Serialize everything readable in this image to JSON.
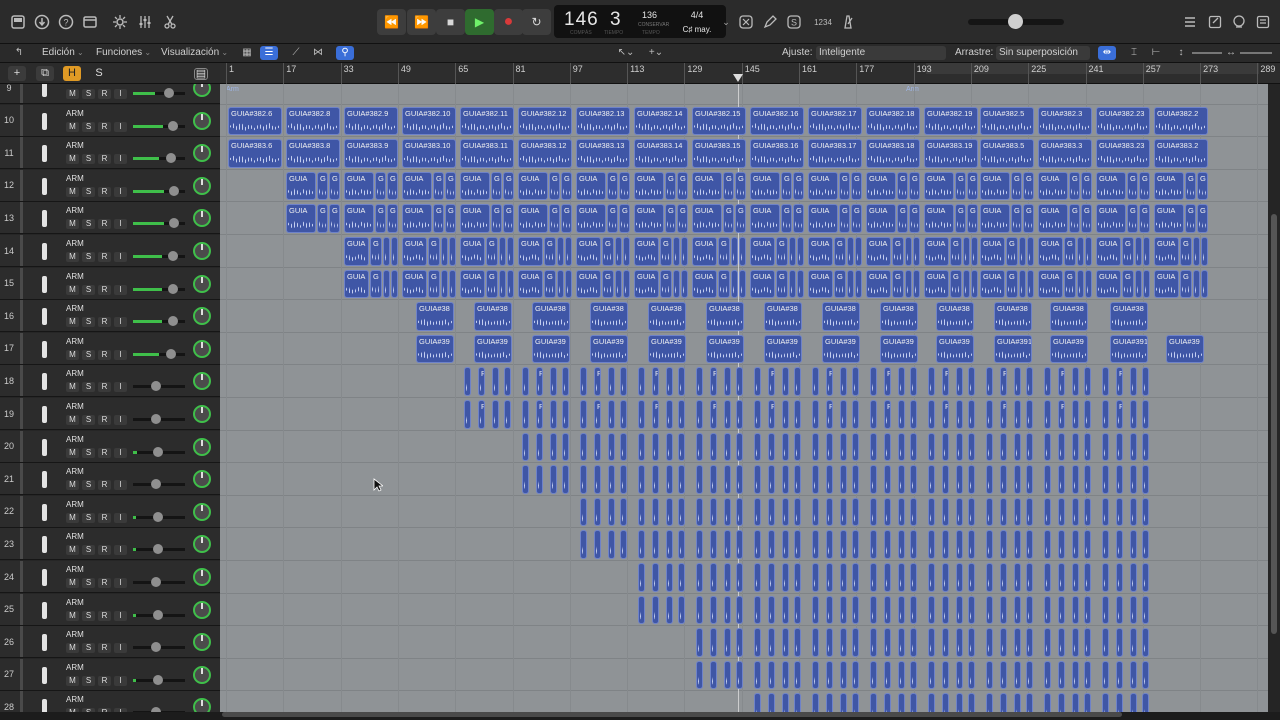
{
  "control_bar": {
    "left_icons": [
      "library-icon",
      "info-icon",
      "help-icon",
      "editors-icon",
      "settings-icon",
      "mixer-icon",
      "scissors-icon"
    ],
    "transport": {
      "rewind": "⏪",
      "forward": "⏩",
      "stop": "■",
      "play": "▶",
      "record": "●",
      "cycle": "↻"
    },
    "lcd": {
      "bars": "146",
      "beat": "3",
      "bars_label": "COMPÁS",
      "beat_label": "TIEMPO",
      "tempo": "136",
      "tempo_label": "CONSERVAR",
      "tempo_sublabel": "TEMPO",
      "signature": "4/4",
      "key": "C♯ may."
    },
    "right_icons": [
      "tuner-icon",
      "pencil-icon",
      "solo-icon",
      "count-in-icon",
      "metronome-icon"
    ],
    "count_in": "1234",
    "master_volume": 0.5,
    "far_right_icons": [
      "list-icon",
      "notepad-icon",
      "loops-icon",
      "browser-icon"
    ]
  },
  "toolbar": {
    "menus": [
      "Edición",
      "Funciones",
      "Visualización"
    ],
    "snap_label": "Ajuste:",
    "snap_value": "Inteligente",
    "drag_label": "Arrastre:",
    "drag_value": "Sin superposición"
  },
  "track_header": {
    "add": "+",
    "h": "H",
    "s": "S"
  },
  "tracks": [
    {
      "num": "9",
      "name": "",
      "vol": 0.42
    },
    {
      "num": "10",
      "name": "ARM",
      "vol": 0.58
    },
    {
      "num": "11",
      "name": "ARM",
      "vol": 0.5
    },
    {
      "num": "12",
      "name": "ARM",
      "vol": 0.6
    },
    {
      "num": "13",
      "name": "ARM",
      "vol": 0.6
    },
    {
      "num": "14",
      "name": "ARM",
      "vol": 0.55
    },
    {
      "num": "15",
      "name": "ARM",
      "vol": 0.55
    },
    {
      "num": "16",
      "name": "ARM",
      "vol": 0.55
    },
    {
      "num": "17",
      "name": "ARM",
      "vol": 0.5
    },
    {
      "num": "18",
      "name": "ARM",
      "vol": 0
    },
    {
      "num": "19",
      "name": "ARM",
      "vol": 0
    },
    {
      "num": "20",
      "name": "ARM",
      "vol": 0.08
    },
    {
      "num": "21",
      "name": "ARM",
      "vol": 0
    },
    {
      "num": "22",
      "name": "ARM",
      "vol": 0.05
    },
    {
      "num": "23",
      "name": "ARM",
      "vol": 0.05
    },
    {
      "num": "24",
      "name": "ARM",
      "vol": 0
    },
    {
      "num": "25",
      "name": "ARM",
      "vol": 0.05
    },
    {
      "num": "26",
      "name": "ARM",
      "vol": 0
    },
    {
      "num": "27",
      "name": "ARM",
      "vol": 0.05
    },
    {
      "num": "28",
      "name": "ARM",
      "vol": 0
    }
  ],
  "track_button_labels": [
    "M",
    "S",
    "R",
    "I"
  ],
  "ruler": [
    "1",
    "17",
    "33",
    "49",
    "65",
    "81",
    "97",
    "113",
    "129",
    "145",
    "161",
    "177",
    "193",
    "209",
    "225",
    "241",
    "257",
    "273",
    "289"
  ],
  "markers": [
    "Arm",
    "Arm"
  ],
  "regions": {
    "row10": [
      "GUIA#382.6",
      "GUIA#382.8",
      "GUIA#382.9",
      "GUIA#382.10",
      "GUIA#382.11",
      "GUIA#382.12",
      "GUIA#382.13",
      "GUIA#382.14",
      "GUIA#382.15",
      "GUIA#382.16",
      "GUIA#382.17",
      "GUIA#382.18",
      "GUIA#382.19",
      "GUIA#382.5",
      "GUIA#382.3",
      "GUIA#382.23",
      "GUIA#382.2"
    ],
    "row11": [
      "GUIA#383.6",
      "GUIA#383.8",
      "GUIA#383.9",
      "GUIA#383.10",
      "GUIA#383.11",
      "GUIA#383.12",
      "GUIA#383.13",
      "GUIA#383.14",
      "GUIA#383.15",
      "GUIA#383.16",
      "GUIA#383.17",
      "GUIA#383.18",
      "GUIA#383.19",
      "GUIA#383.5",
      "GUIA#383.3",
      "GUIA#383.23",
      "GUIA#383.2"
    ],
    "row12_label": "GUIA",
    "row12_short": "G",
    "row14_label": "GUIA",
    "row16": [
      "GUIA#38",
      "GUIA#38",
      "GUIA#38",
      "GUIA#38",
      "GUIA#38",
      "GUIA#38",
      "GUIA#38",
      "GUIA#38",
      "GUIA#38",
      "GUIA#38",
      "GUIA#38",
      "GUIA#38",
      "GUIA#38"
    ],
    "row17": [
      "GUIA#39",
      "GUIA#39",
      "GUIA#39",
      "GUIA#39",
      "GUIA#39",
      "GUIA#39",
      "GUIA#39",
      "GUIA#39",
      "GUIA#39",
      "GUIA#39",
      "GUIA#391",
      "GUIA#39",
      "GUIA#391",
      "GUIA#39"
    ],
    "small_label": "R",
    "small_label_re": "RE"
  },
  "colors": {
    "region": "#3f56a6",
    "region_border": "#6e82c9",
    "arrange_bg": "#8f9396",
    "play": "#6ff26a",
    "record": "#d93a3a",
    "h_button": "#e09a25"
  }
}
